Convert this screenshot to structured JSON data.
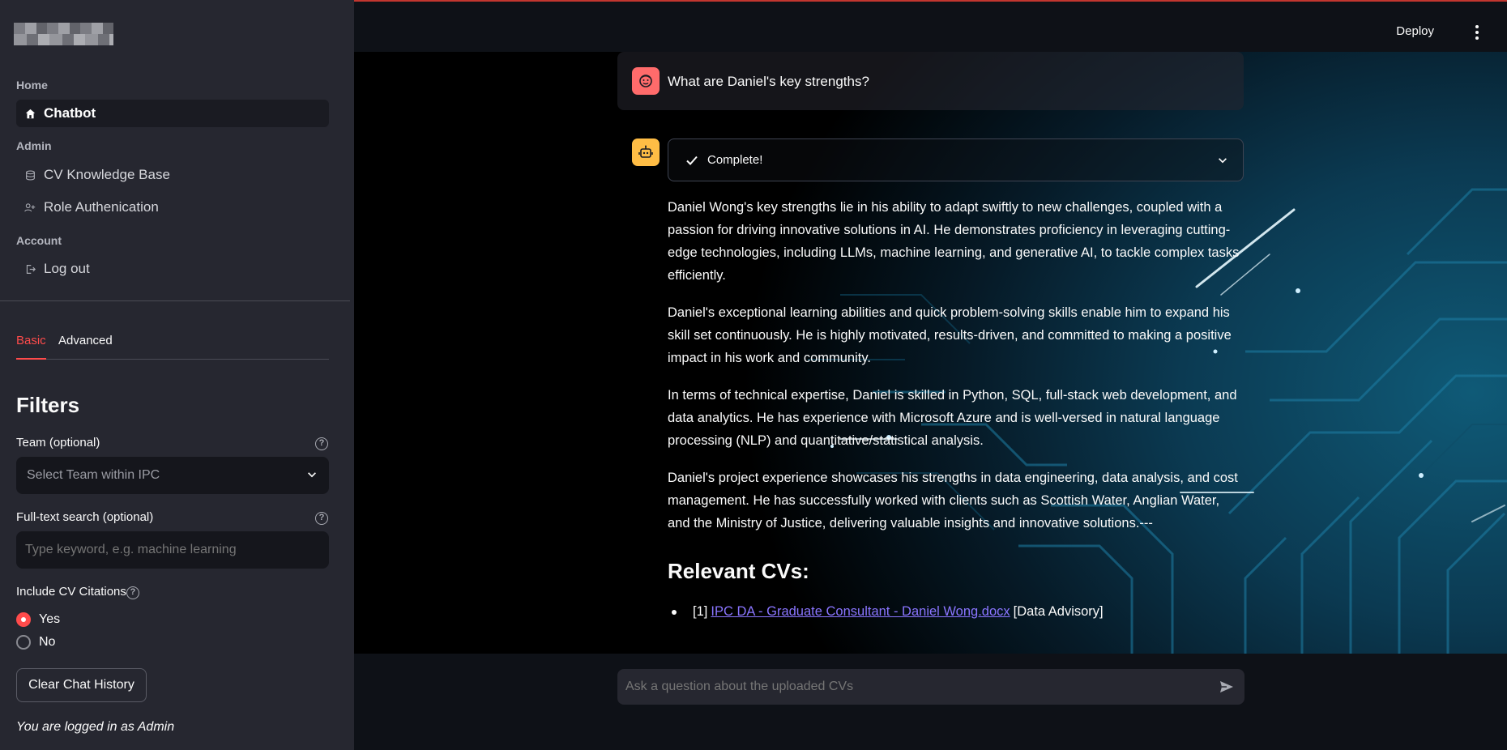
{
  "sidebar": {
    "sections": [
      {
        "label": "Home"
      },
      {
        "label": "Admin"
      },
      {
        "label": "Account"
      }
    ],
    "items": [
      {
        "label": "Chatbot",
        "icon": "home-icon",
        "active": true
      },
      {
        "label": "CV Knowledge Base",
        "icon": "database-icon"
      },
      {
        "label": "Role Authenication",
        "icon": "user-add-icon"
      },
      {
        "label": "Log out",
        "icon": "logout-icon"
      }
    ],
    "tabs": [
      {
        "label": "Basic",
        "active": true
      },
      {
        "label": "Advanced"
      }
    ],
    "filters_title": "Filters",
    "team_label": "Team (optional)",
    "team_placeholder": "Select Team within IPC",
    "search_label": "Full-text search (optional)",
    "search_placeholder": "Type keyword, e.g. machine learning",
    "citations_label": "Include CV Citations",
    "citations_options": [
      {
        "label": "Yes",
        "selected": true
      },
      {
        "label": "No",
        "selected": false
      }
    ],
    "clear_button": "Clear Chat History",
    "logged_in_text": "You are logged in as Admin"
  },
  "header": {
    "deploy_label": "Deploy"
  },
  "chat": {
    "user_question": "What are Daniel's key strengths?",
    "status_label": "Complete!",
    "answer_paragraphs": [
      "Daniel Wong's key strengths lie in his ability to adapt swiftly to new challenges, coupled with a passion for driving innovative solutions in AI. He demonstrates proficiency in leveraging cutting-edge technologies, including LLMs, machine learning, and generative AI, to tackle complex tasks efficiently.",
      "Daniel's exceptional learning abilities and quick problem-solving skills enable him to expand his skill set continuously. He is highly motivated, results-driven, and committed to making a positive impact in his work and community.",
      "In terms of technical expertise, Daniel is skilled in Python, SQL, full-stack web development, and data analytics. He has experience with Microsoft Azure and is well-versed in natural language processing (NLP) and quantitative/statistical analysis.",
      "Daniel's project experience showcases his strengths in data engineering, data analysis, and cost management. He has successfully worked with clients such as Scottish Water, Anglian Water, and the Ministry of Justice, delivering valuable insights and innovative solutions.---"
    ],
    "relevant_title": "Relevant CVs:",
    "citations": [
      {
        "index": "[1]",
        "link_text": "IPC DA - Graduate Consultant - Daniel Wong.docx",
        "tag": "[Data Advisory]"
      }
    ],
    "input_placeholder": "Ask a question about the uploaded CVs"
  },
  "colors": {
    "accent": "#ff4b4b",
    "link": "#8a75ff",
    "sidebar_bg": "#262730",
    "main_bg": "#0e1117"
  }
}
